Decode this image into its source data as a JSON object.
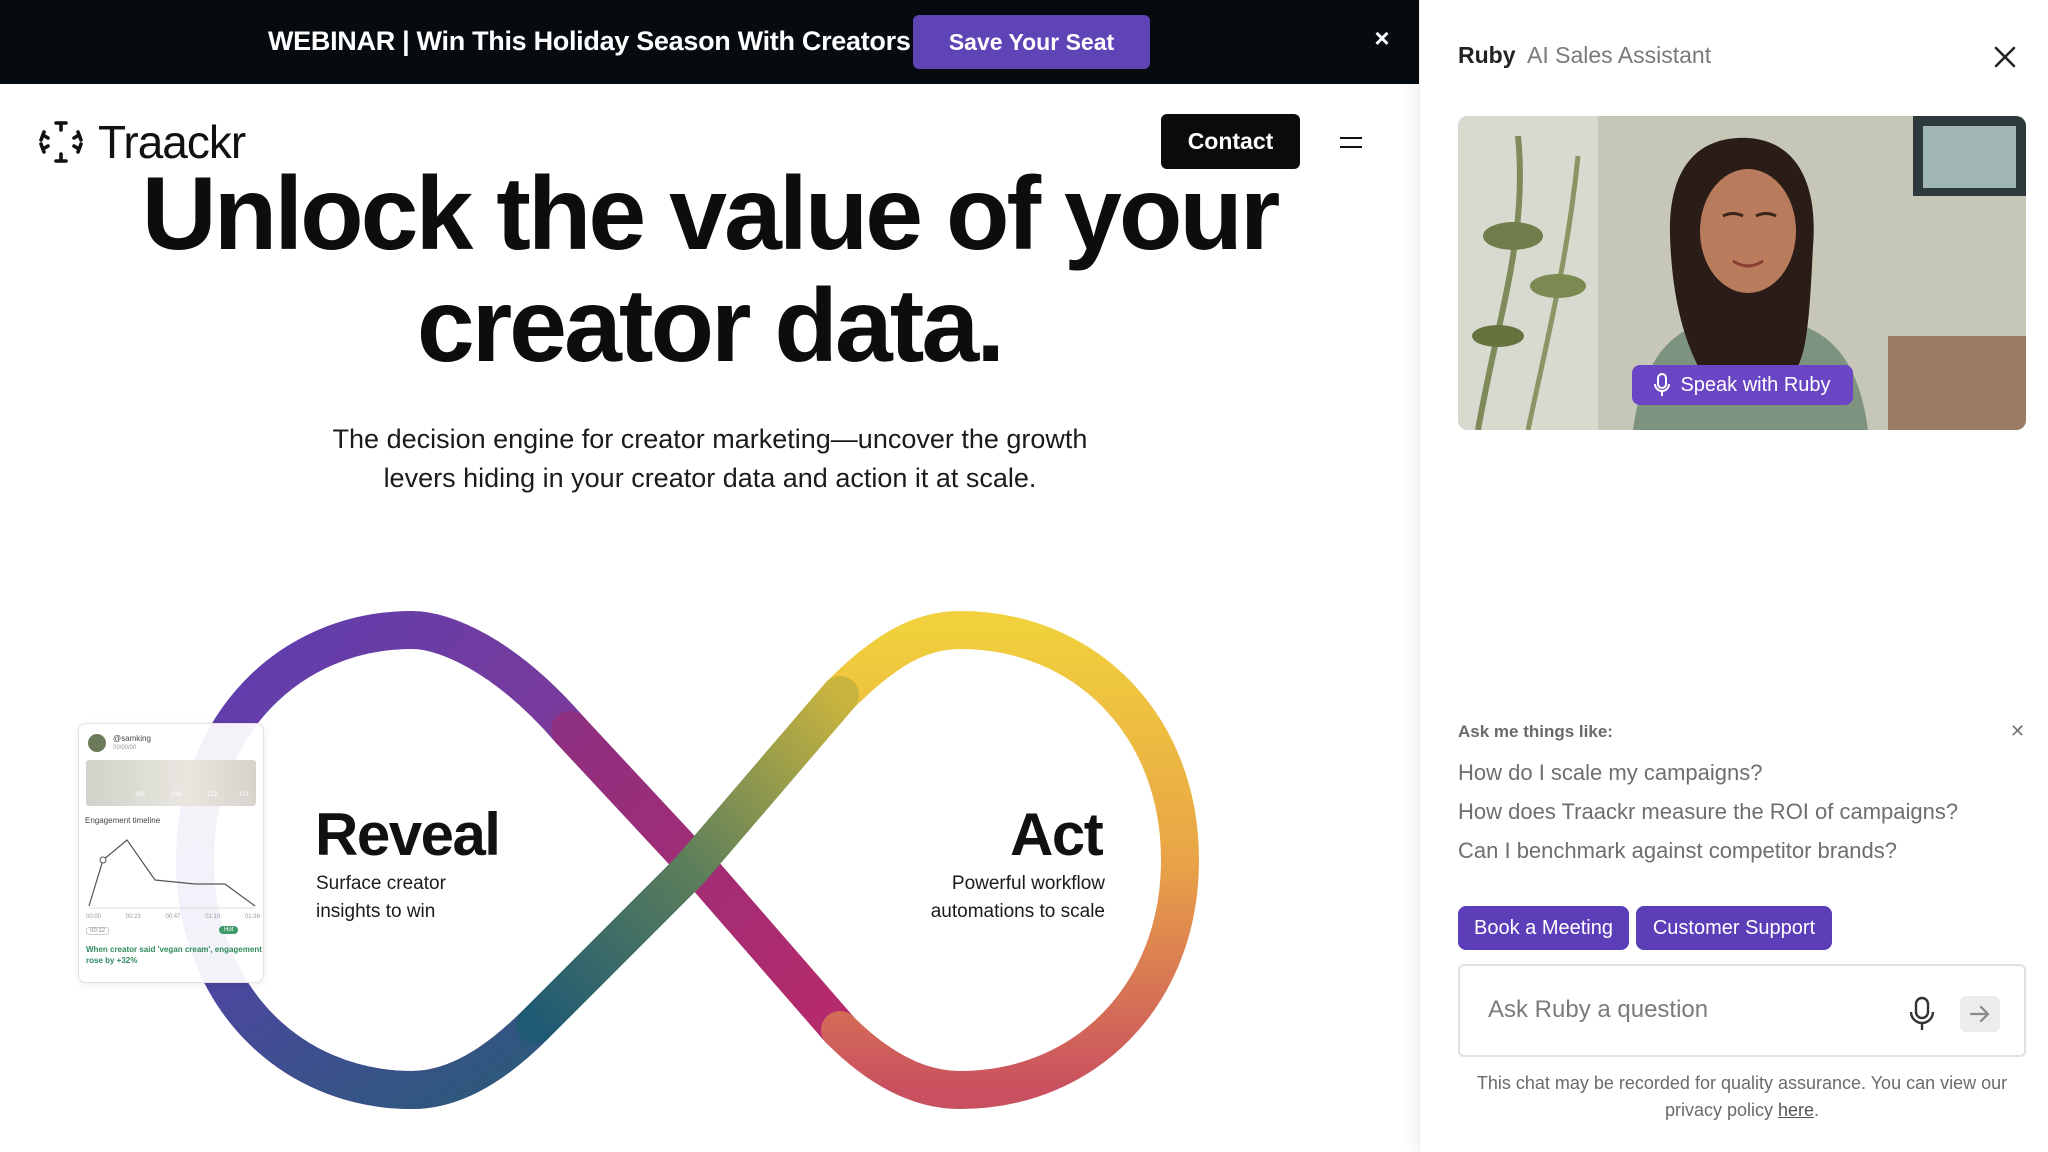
{
  "banner": {
    "text": "WEBINAR | Win This Holiday Season With Creators",
    "cta_label": "Save Your Seat",
    "close_label": "×"
  },
  "header": {
    "logo_text": "Traackr",
    "contact_label": "Contact",
    "menu_icon": "hamburger-icon"
  },
  "hero": {
    "title_line1": "Unlock the value of your",
    "title_line2": "creator data.",
    "subtitle_line1": "The decision engine for creator marketing—uncover the growth",
    "subtitle_line2": "levers hiding in your creator data and action it at scale."
  },
  "infinity": {
    "left_title": "Reveal",
    "left_sub_line1": "Surface creator",
    "left_sub_line2": "insights to win",
    "right_title": "Act",
    "right_sub_line1": "Powerful workflow",
    "right_sub_line2": "automations to scale"
  },
  "mini_card": {
    "handle": "@samking",
    "date": "00/00/00",
    "stats": [
      "435",
      "218",
      "123",
      "101"
    ],
    "timeline_label": "Engagement timeline",
    "tick_labels": [
      "00:00",
      "00:23",
      "00:47",
      "01:10",
      "01:38"
    ],
    "timestamp": "00:12",
    "badge": "Hot",
    "note": "When creator said 'vegan cream', engagement rose by +32%"
  },
  "chat": {
    "name": "Ruby",
    "role": "AI Sales Assistant",
    "speak_label": "Speak with Ruby",
    "ask_label": "Ask me things like:",
    "suggestions": [
      "How do I scale my campaigns?",
      "How does Traackr measure the ROI of campaigns?",
      "Can I benchmark against competitor brands?"
    ],
    "chips": [
      "Book a Meeting",
      "Customer Support"
    ],
    "input_placeholder": "Ask Ruby a question",
    "disclaimer_text": "This chat may be recorded for quality assurance. You can view our privacy policy ",
    "privacy_link": "here",
    "disclaimer_end": "."
  },
  "colors": {
    "accent": "#5c3eb8",
    "banner_bg": "#050b0f",
    "infinity_purple": "#6a3ea8",
    "infinity_yellow": "#f2c93a",
    "infinity_pink": "#b8286e",
    "infinity_teal": "#2e6b7a"
  }
}
